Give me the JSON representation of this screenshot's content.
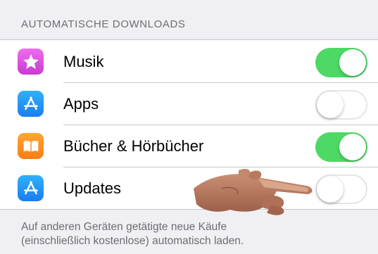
{
  "section": {
    "title": "AUTOMATISCHE DOWNLOADS"
  },
  "rows": [
    {
      "label": "Musik",
      "icon": "star-icon",
      "icon_color": "#d94fe0",
      "enabled": true
    },
    {
      "label": "Apps",
      "icon": "app-store-icon",
      "icon_color": "#1d8cf8",
      "enabled": false
    },
    {
      "label": "Bücher & Hörbücher",
      "icon": "open-book-icon",
      "icon_color": "#fd8f1f",
      "enabled": true
    },
    {
      "label": "Updates",
      "icon": "app-store-icon",
      "icon_color": "#1d8cf8",
      "enabled": false
    }
  ],
  "footer": {
    "text_line1": "Auf anderen Geräten getätigte neue Käufe",
    "text_line2": "(einschließlich kostenlose) automatisch laden."
  },
  "colors": {
    "toggle_on": "#4cd964",
    "toggle_off_border": "#e5e5ea",
    "background": "#efeff4",
    "secondary_text": "#6d6d72"
  }
}
